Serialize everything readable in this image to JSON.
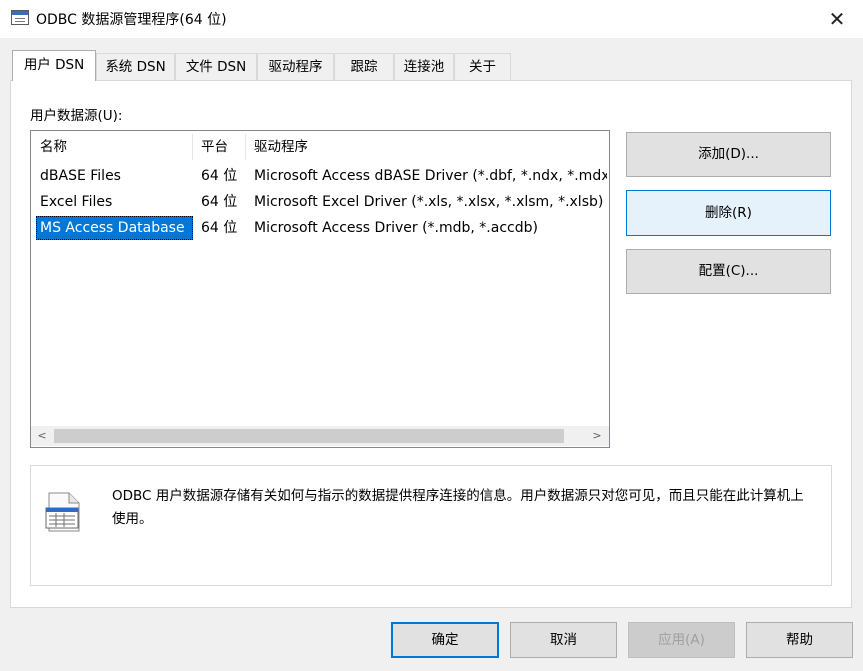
{
  "window": {
    "title": "ODBC 数据源管理程序(64 位)",
    "close_glyph": "✕"
  },
  "tabs": [
    {
      "label": "用户 DSN",
      "active": true
    },
    {
      "label": "系统 DSN",
      "active": false
    },
    {
      "label": "文件 DSN",
      "active": false
    },
    {
      "label": "驱动程序",
      "active": false
    },
    {
      "label": "跟踪",
      "active": false
    },
    {
      "label": "连接池",
      "active": false
    },
    {
      "label": "关于",
      "active": false
    }
  ],
  "user_dsn": {
    "list_label": "用户数据源(U):",
    "columns": [
      "名称",
      "平台",
      "驱动程序"
    ],
    "rows": [
      {
        "name": "dBASE Files",
        "platform": "64 位",
        "driver": "Microsoft Access dBASE Driver (*.dbf, *.ndx, *.mdx)",
        "selected": false
      },
      {
        "name": "Excel Files",
        "platform": "64 位",
        "driver": "Microsoft Excel Driver (*.xls, *.xlsx, *.xlsm, *.xlsb)",
        "selected": false
      },
      {
        "name": "MS Access Database",
        "platform": "64 位",
        "driver": "Microsoft Access Driver (*.mdb, *.accdb)",
        "selected": true
      }
    ],
    "scroll_left": "<",
    "scroll_right": ">",
    "buttons": {
      "add": "添加(D)...",
      "remove": "删除(R)",
      "configure": "配置(C)..."
    },
    "info_text": "ODBC 用户数据源存储有关如何与指示的数据提供程序连接的信息。用户数据源只对您可见，而且只能在此计算机上使用。",
    "info_icon": "data-source-icon"
  },
  "footer": {
    "ok": "确定",
    "cancel": "取消",
    "apply": "应用(A)",
    "help": "帮助"
  },
  "colors": {
    "accent": "#0078d7",
    "selection": "#0078d7",
    "panel": "#ffffff",
    "window": "#f0f0f0"
  }
}
